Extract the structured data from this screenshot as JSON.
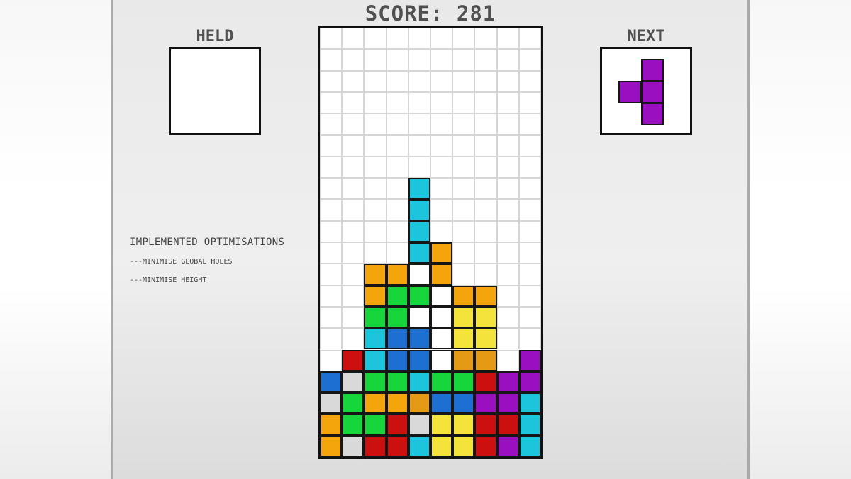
{
  "score": {
    "text": "SCORE: 281"
  },
  "held": {
    "title": "HELD",
    "piece": []
  },
  "next": {
    "title": "NEXT",
    "color": "#9a10c0",
    "cells": [
      [
        1,
        0
      ],
      [
        0,
        1
      ],
      [
        1,
        1
      ],
      [
        1,
        2
      ]
    ]
  },
  "optimisations": {
    "title": "IMPLEMENTED OPTIMISATIONS",
    "items": [
      "---MINIMISE GLOBAL HOLES",
      "---MINIMISE HEIGHT"
    ]
  },
  "colors": {
    "O": "#f5a50c",
    "G": "#17d63c",
    "C": "#1cc4dc",
    "B": "#1e6fd2",
    "Y": "#f4e33a",
    "R": "#cc1010",
    "P": "#9a10c0",
    "W": "#ffffff",
    "L": "#d9d9d9",
    "A": "#e49a14"
  },
  "board": {
    "cols": 10,
    "rows": 20,
    "grid": [
      "..........",
      "..........",
      "..........",
      "..........",
      "..........",
      "..........",
      "..........",
      "....C.....",
      "....C.....",
      "....C.....",
      "....CO....",
      "..OOWO....",
      "..OGGWOO..",
      "..GGWWYY..",
      "..CBBWYY..",
      ".RCBBWAA.P",
      "BLGGCGGRPP",
      "LGOOABBPPC",
      "OGGRLYYRRC",
      "OLRRCYYRPC"
    ]
  }
}
